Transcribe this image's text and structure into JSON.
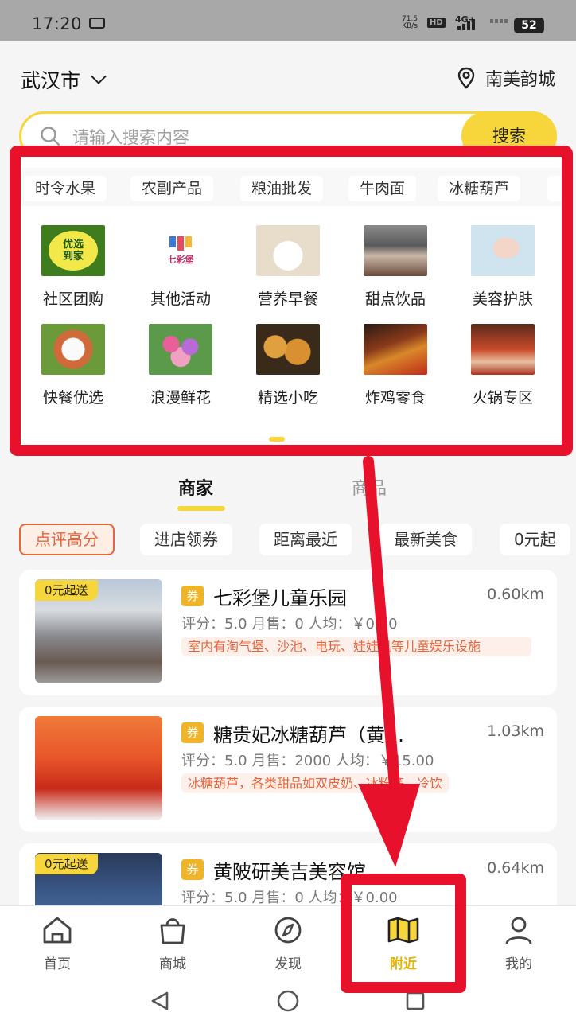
{
  "status_bar": {
    "time": "17:20",
    "net_speed": "71.5",
    "net_unit": "KB/s",
    "hd": "HD",
    "signal": "4G+",
    "battery": "52"
  },
  "header": {
    "city": "武汉市",
    "location": "南美韵城"
  },
  "search": {
    "placeholder": "请输入搜索内容",
    "button": "搜索"
  },
  "quick_chips": [
    "时令水果",
    "农副产品",
    "粮油批发",
    "牛肉面",
    "冰糖葫芦"
  ],
  "categories": [
    {
      "label": "社区团购",
      "icon": "community-groupbuy-icon",
      "color": "#4a8a2a",
      "text": "优选\n到家"
    },
    {
      "label": "其他活动",
      "icon": "other-activities-icon",
      "color": "#ffffff",
      "text": "七彩堡"
    },
    {
      "label": "营养早餐",
      "icon": "breakfast-icon",
      "color": "#e8dccb"
    },
    {
      "label": "甜点饮品",
      "icon": "dessert-icon",
      "color": "#6b6b6b"
    },
    {
      "label": "美容护肤",
      "icon": "beauty-icon",
      "color": "#cfe4ee"
    },
    {
      "label": "快餐优选",
      "icon": "fastfood-icon",
      "color": "#c75a3a"
    },
    {
      "label": "浪漫鲜花",
      "icon": "flowers-icon",
      "color": "#c6579a"
    },
    {
      "label": "精选小吃",
      "icon": "snacks-icon",
      "color": "#c98a3a"
    },
    {
      "label": "炸鸡零食",
      "icon": "fried-chicken-icon",
      "color": "#8a2a1a"
    },
    {
      "label": "火锅专区",
      "icon": "hotpot-icon",
      "color": "#a83220"
    }
  ],
  "tabs": {
    "merchants": "商家",
    "products": "商品"
  },
  "filters": [
    "点评高分",
    "进店领券",
    "距离最近",
    "最新美食",
    "0元起"
  ],
  "merchants": [
    {
      "badge": "0元起送",
      "coupon": "券",
      "name": "七彩堡儿童乐园",
      "distance": "0.60km",
      "meta": "评分：5.0    月售：0    人均：￥0.00",
      "desc": "室内有淘气堡、沙池、电玩、娃娃机等儿童娱乐设施",
      "thumb_color": "#7a8a9a"
    },
    {
      "badge": "",
      "coupon": "券",
      "name": "糖贵妃冰糖葫芦（黄…",
      "distance": "1.03km",
      "meta": "评分：5.0    月售：2000    人均：￥15.00",
      "desc": "冰糖葫芦，各类甜品如双皮奶、冰粉等、冷饮",
      "thumb_color": "#d8432a"
    },
    {
      "badge": "0元起送",
      "coupon": "券",
      "name": "黄陂研美吉美容馆",
      "distance": "0.64km",
      "meta": "评分：5.0    月售：0    人均：￥0.00",
      "desc": "",
      "thumb_color": "#3b5a8a"
    }
  ],
  "bottom_nav": [
    {
      "label": "首页",
      "icon": "home-icon"
    },
    {
      "label": "商城",
      "icon": "shopping-bag-icon"
    },
    {
      "label": "发现",
      "icon": "compass-icon"
    },
    {
      "label": "附近",
      "icon": "map-icon"
    },
    {
      "label": "我的",
      "icon": "user-icon"
    }
  ],
  "colors": {
    "accent": "#f7d63c",
    "highlight": "#e8112c",
    "filter_active": "#e8643c"
  }
}
